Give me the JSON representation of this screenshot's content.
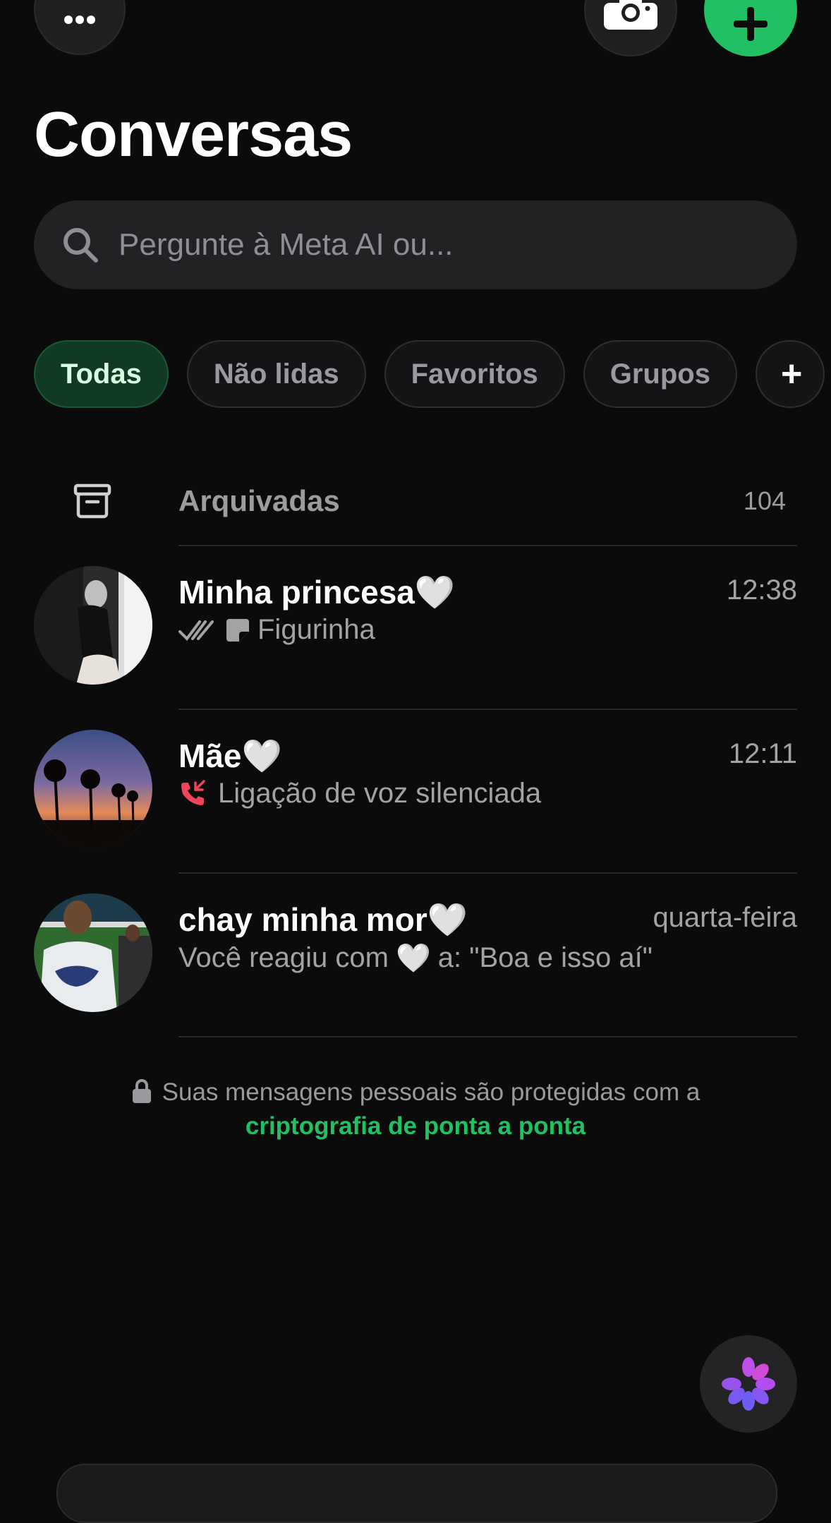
{
  "header": {
    "title": "Conversas",
    "menu_icon": "more-horizontal-icon",
    "camera_icon": "camera-icon",
    "new_chat_icon": "plus-icon"
  },
  "search": {
    "placeholder": "Pergunte à Meta AI ou...",
    "icon": "search-icon"
  },
  "filters": [
    {
      "label": "Todas",
      "active": true
    },
    {
      "label": "Não lidas",
      "active": false
    },
    {
      "label": "Favoritos",
      "active": false
    },
    {
      "label": "Grupos",
      "active": false
    },
    {
      "label": "+",
      "active": false
    }
  ],
  "archived": {
    "label": "Arquivadas",
    "count": "104",
    "icon": "archive-icon"
  },
  "chats": [
    {
      "name": "Minha princesa",
      "emoji": "🤍",
      "time": "12:38",
      "preview": "Figurinha",
      "preview_icons": [
        "double-check-icon",
        "sticker-icon"
      ]
    },
    {
      "name": "Mãe",
      "emoji": "🤍",
      "time": "12:11",
      "preview": "Ligação de voz silenciada",
      "preview_icons": [
        "missed-call-icon"
      ]
    },
    {
      "name": "chay minha mor",
      "emoji": "🤍",
      "time": "quarta-feira",
      "preview_prefix": "Você reagiu com",
      "preview_emoji": "🤍",
      "preview_suffix": "a: \"Boa e isso aí\""
    }
  ],
  "encryption_notice": {
    "text": "Suas mensagens pessoais são protegidas com a",
    "link": "criptografia de ponta a ponta"
  },
  "colors": {
    "accent": "#21c063",
    "background": "#0b0b0c",
    "active_chip": "#103a24",
    "missed_call": "#f0445a"
  }
}
